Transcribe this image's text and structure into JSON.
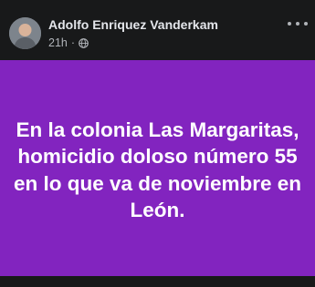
{
  "post": {
    "author": "Adolfo Enriquez Vanderkam",
    "time": "21h",
    "separator": "·",
    "privacy_icon": "globe-icon",
    "more_icon": "more-options-icon",
    "avatar_icon": "profile-photo",
    "panel_color": "#8224bf",
    "text": "En la colonia Las Margaritas, homicidio doloso número 55 en lo que va de noviembre en León."
  }
}
